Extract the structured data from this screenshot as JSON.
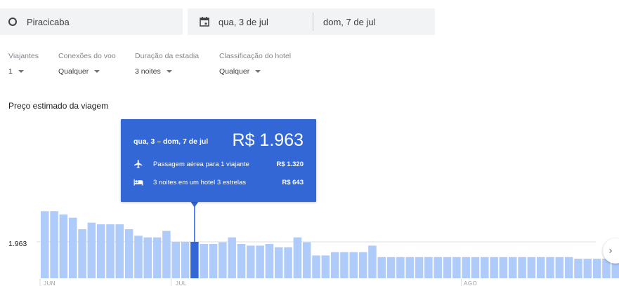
{
  "search": {
    "origin": "Piracicaba",
    "depart_date": "qua, 3 de jul",
    "return_date": "dom, 7 de jul"
  },
  "filters": [
    {
      "label": "Viajantes",
      "value": "1"
    },
    {
      "label": "Conexões do voo",
      "value": "Qualquer"
    },
    {
      "label": "Duração da estadia",
      "value": "3 noites"
    },
    {
      "label": "Classificação do hotel",
      "value": "Qualquer"
    }
  ],
  "section_title": "Preço estimado da viagem",
  "tooltip": {
    "dates": "qua, 3 – dom, 7 de jul",
    "total": "R$ 1.963",
    "flight_label": "Passagem aérea para 1 viajante",
    "flight_price": "R$ 1.320",
    "hotel_label": "3 noites em um hotel 3 estrelas",
    "hotel_price": "R$ 643"
  },
  "icons": {
    "origin": "origin-circle-icon",
    "calendar": "calendar-icon",
    "flight": "airplane-icon",
    "hotel": "bed-icon",
    "next": "chevron-right-icon"
  },
  "colors": {
    "bar": "#aecbfa",
    "bar_selected": "#3367d6",
    "tooltip_bg": "#3367d6",
    "field_bg": "#f1f3f4"
  },
  "chart_data": {
    "type": "bar",
    "y_reference_label": "1.963",
    "y_reference_value": 1963,
    "selected_index": 16,
    "month_labels": [
      "JUN",
      "JUL",
      "AGO"
    ],
    "month_start_indices": [
      0,
      14,
      45
    ],
    "values": [
      2150,
      2150,
      2130,
      2110,
      2040,
      2080,
      2070,
      2070,
      2070,
      2040,
      2000,
      1990,
      1990,
      2030,
      1963,
      1963,
      1963,
      1950,
      1950,
      1960,
      1990,
      1950,
      1940,
      1940,
      1950,
      1930,
      1930,
      1990,
      1960,
      1880,
      1880,
      1900,
      1900,
      1900,
      1900,
      1940,
      1870,
      1870,
      1870,
      1870,
      1870,
      1870,
      1870,
      1870,
      1870,
      1870,
      1870,
      1870,
      1870,
      1870,
      1870,
      1870,
      1870,
      1870,
      1870,
      1870,
      1870,
      1860,
      1860,
      1860,
      1860,
      1860
    ]
  }
}
